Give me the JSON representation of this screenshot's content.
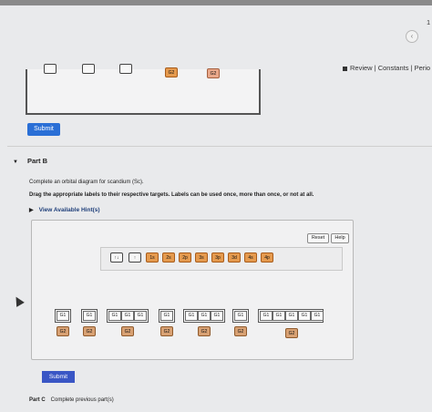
{
  "header": {
    "corner_number": "1",
    "nav_icon": "chevron-left-icon",
    "review_links": "Review | Constants | Perio"
  },
  "partA": {
    "answer_labels": [
      {
        "text": "",
        "style": "plain"
      },
      {
        "text": "",
        "style": "plain"
      },
      {
        "text": "",
        "style": "plain"
      },
      {
        "text": "G2",
        "style": "orange"
      },
      {
        "text": "G2",
        "style": "salmon"
      }
    ],
    "submit_label": "Submit"
  },
  "partB": {
    "title": "Part B",
    "question": "Complete an orbital diagram for scandium (Sc).",
    "instructions": "Drag the appropriate labels to their respective targets. Labels can be used once, more than once, or not at all.",
    "hints_label": "View Available Hint(s)",
    "reset_label": "Reset",
    "help_label": "Help",
    "tray_labels": [
      {
        "text": "↑↓",
        "style": "plain"
      },
      {
        "text": "↑",
        "style": "plain"
      },
      {
        "text": "1s",
        "style": "orange"
      },
      {
        "text": "2s",
        "style": "orange"
      },
      {
        "text": "2p",
        "style": "orange"
      },
      {
        "text": "3s",
        "style": "orange"
      },
      {
        "text": "3p",
        "style": "orange"
      },
      {
        "text": "3d",
        "style": "orange"
      },
      {
        "text": "4s",
        "style": "orange"
      },
      {
        "text": "4p",
        "style": "orange"
      }
    ],
    "slot_group_label": "G1",
    "target_label": "G2",
    "submit_label": "Submit"
  },
  "partC": {
    "title": "Part C",
    "status": "Complete previous part(s)"
  },
  "colors": {
    "submit_blue": "#2a6fd6",
    "label_orange": "#e59a4e",
    "hint_blue": "#1f3f7a"
  }
}
